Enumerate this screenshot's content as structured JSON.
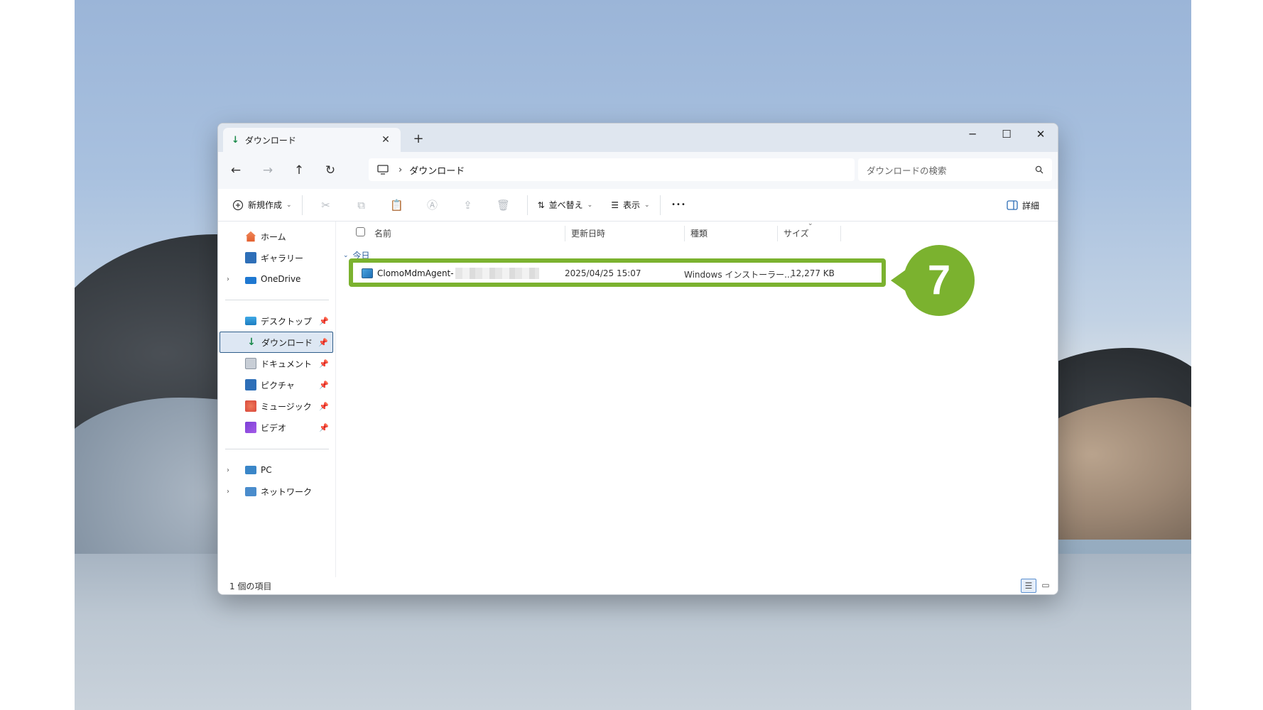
{
  "window": {
    "tab_title": "ダウンロード",
    "new_tab": "+",
    "minimize": "─",
    "maximize": "☐",
    "close": "✕"
  },
  "nav": {
    "back": "←",
    "forward": "→",
    "up": "↑",
    "refresh": "↻",
    "breadcrumb_sep": "›",
    "address": "ダウンロード",
    "search_placeholder": "ダウンロードの検索"
  },
  "toolbar": {
    "new_label": "新規作成",
    "sort_label": "並べ替え",
    "view_label": "表示",
    "more": "•••",
    "details_label": "詳細"
  },
  "sidebar": {
    "items": [
      {
        "label": "ホーム",
        "icon": "home-icon"
      },
      {
        "label": "ギャラリー",
        "icon": "gallery-icon"
      },
      {
        "label": "OneDrive",
        "icon": "onedrive-icon"
      },
      {
        "label": "デスクトップ",
        "icon": "desktop-folder-icon"
      },
      {
        "label": "ダウンロード",
        "icon": "downloads-folder-icon"
      },
      {
        "label": "ドキュメント",
        "icon": "documents-folder-icon"
      },
      {
        "label": "ピクチャ",
        "icon": "pictures-folder-icon"
      },
      {
        "label": "ミュージック",
        "icon": "music-folder-icon"
      },
      {
        "label": "ビデオ",
        "icon": "videos-folder-icon"
      },
      {
        "label": "PC",
        "icon": "pc-icon"
      },
      {
        "label": "ネットワーク",
        "icon": "network-icon"
      }
    ]
  },
  "columns": {
    "name": "名前",
    "modified": "更新日時",
    "type": "種類",
    "size": "サイズ"
  },
  "group": {
    "label": "今日"
  },
  "file": {
    "name": "ClomoMdmAgent-",
    "modified": "2025/04/25 15:07",
    "type": "Windows インストーラー...",
    "size": "12,277 KB"
  },
  "callout": {
    "step": "7"
  },
  "status": {
    "count": "1 個の項目"
  },
  "colors": {
    "highlight": "#7bb22f",
    "selection": "#dde7f3"
  }
}
